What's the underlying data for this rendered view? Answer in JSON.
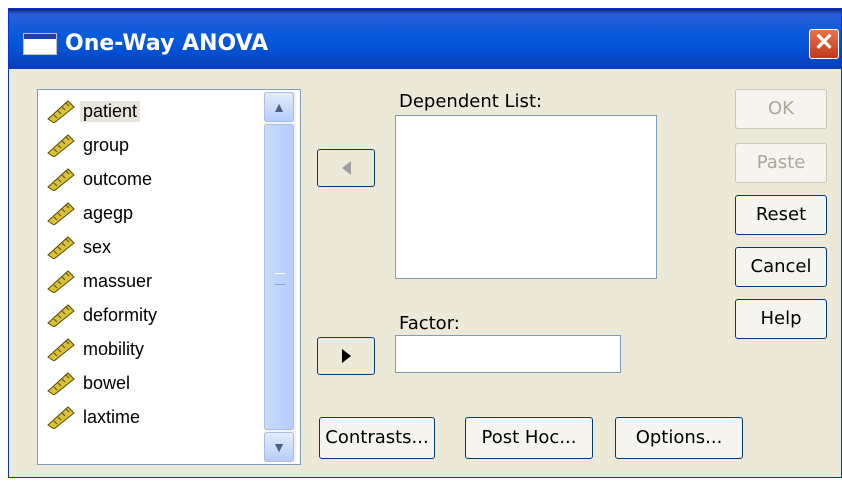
{
  "window": {
    "title": "One-Way ANOVA",
    "close_glyph": "✕"
  },
  "variables": [
    {
      "label": "patient",
      "selected": true,
      "icon": "scale-ruler-icon"
    },
    {
      "label": "group",
      "selected": false,
      "icon": "scale-ruler-icon"
    },
    {
      "label": "outcome",
      "selected": false,
      "icon": "scale-ruler-icon"
    },
    {
      "label": "agegp",
      "selected": false,
      "icon": "scale-ruler-icon"
    },
    {
      "label": "sex",
      "selected": false,
      "icon": "scale-ruler-icon"
    },
    {
      "label": "massuer",
      "selected": false,
      "icon": "scale-ruler-icon"
    },
    {
      "label": "deformity",
      "selected": false,
      "icon": "scale-ruler-icon"
    },
    {
      "label": "mobility",
      "selected": false,
      "icon": "scale-ruler-icon"
    },
    {
      "label": "bowel",
      "selected": false,
      "icon": "scale-ruler-icon"
    },
    {
      "label": "laxtime",
      "selected": false,
      "icon": "scale-ruler-icon"
    }
  ],
  "scrollbar": {
    "up_glyph": "▲",
    "down_glyph": "▼"
  },
  "dependent_list": {
    "label": "Dependent List:"
  },
  "factor": {
    "label": "Factor:",
    "value": ""
  },
  "buttons": {
    "ok": "OK",
    "paste": "Paste",
    "reset": "Reset",
    "cancel": "Cancel",
    "help": "Help",
    "contrasts": "Contrasts...",
    "post_hoc": "Post Hoc...",
    "options": "Options..."
  },
  "colors": {
    "titlebar": "#0a5bdc",
    "dialog_bg": "#ece9d8",
    "close_red": "#c0391c"
  }
}
